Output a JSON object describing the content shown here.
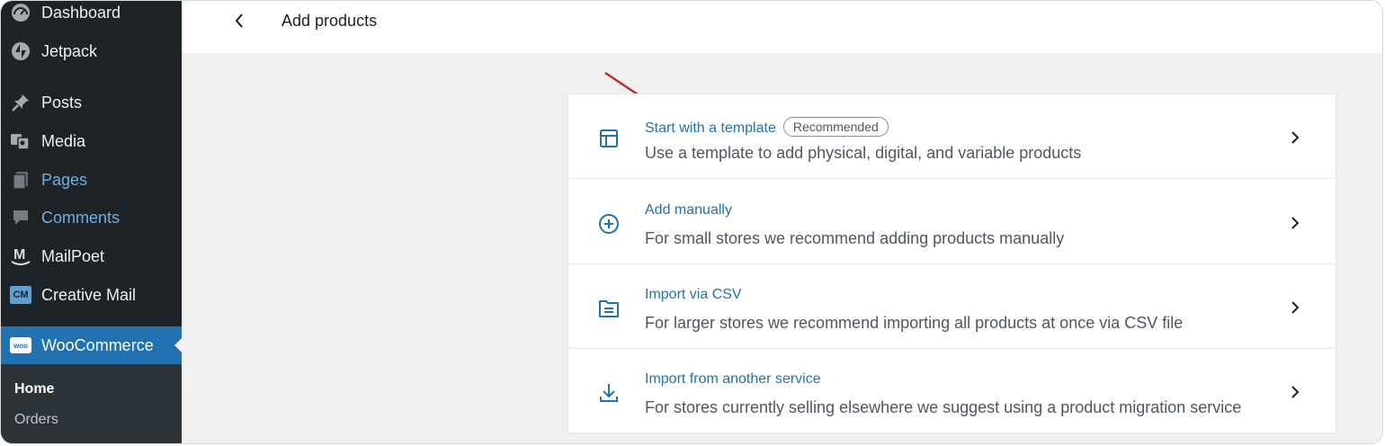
{
  "sidebar": {
    "items": [
      {
        "label": "Dashboard",
        "icon": "dashboard-icon"
      },
      {
        "label": "Jetpack",
        "icon": "jetpack-icon"
      },
      {
        "label": "Posts",
        "icon": "pin-icon"
      },
      {
        "label": "Media",
        "icon": "media-icon"
      },
      {
        "label": "Pages",
        "icon": "pages-icon"
      },
      {
        "label": "Comments",
        "icon": "comments-icon"
      },
      {
        "label": "MailPoet",
        "icon": "mailpoet-icon"
      },
      {
        "label": "Creative Mail",
        "icon": "creative-mail-icon",
        "icon_text": "CM"
      },
      {
        "label": "WooCommerce",
        "icon": "woocommerce-icon",
        "icon_text": "woo"
      }
    ],
    "submenu": [
      {
        "label": "Home"
      },
      {
        "label": "Orders"
      }
    ]
  },
  "header": {
    "title": "Add products",
    "back_icon": "chevron-left-icon"
  },
  "options": [
    {
      "title": "Start with a template",
      "badge": "Recommended",
      "description": "Use a template to add physical, digital, and variable products",
      "icon": "template-icon"
    },
    {
      "title": "Add manually",
      "description": "For small stores we recommend adding products manually",
      "icon": "plus-circle-icon"
    },
    {
      "title": "Import via CSV",
      "description": "For larger stores we recommend importing all products at once via CSV file",
      "icon": "file-icon"
    },
    {
      "title": "Import from another service",
      "description": "For stores currently selling elsewhere we suggest using a product migration service",
      "icon": "download-icon"
    }
  ],
  "colors": {
    "sidebar_bg": "#1d2327",
    "accent": "#2271b1",
    "annotation_arrow": "#c62828"
  }
}
